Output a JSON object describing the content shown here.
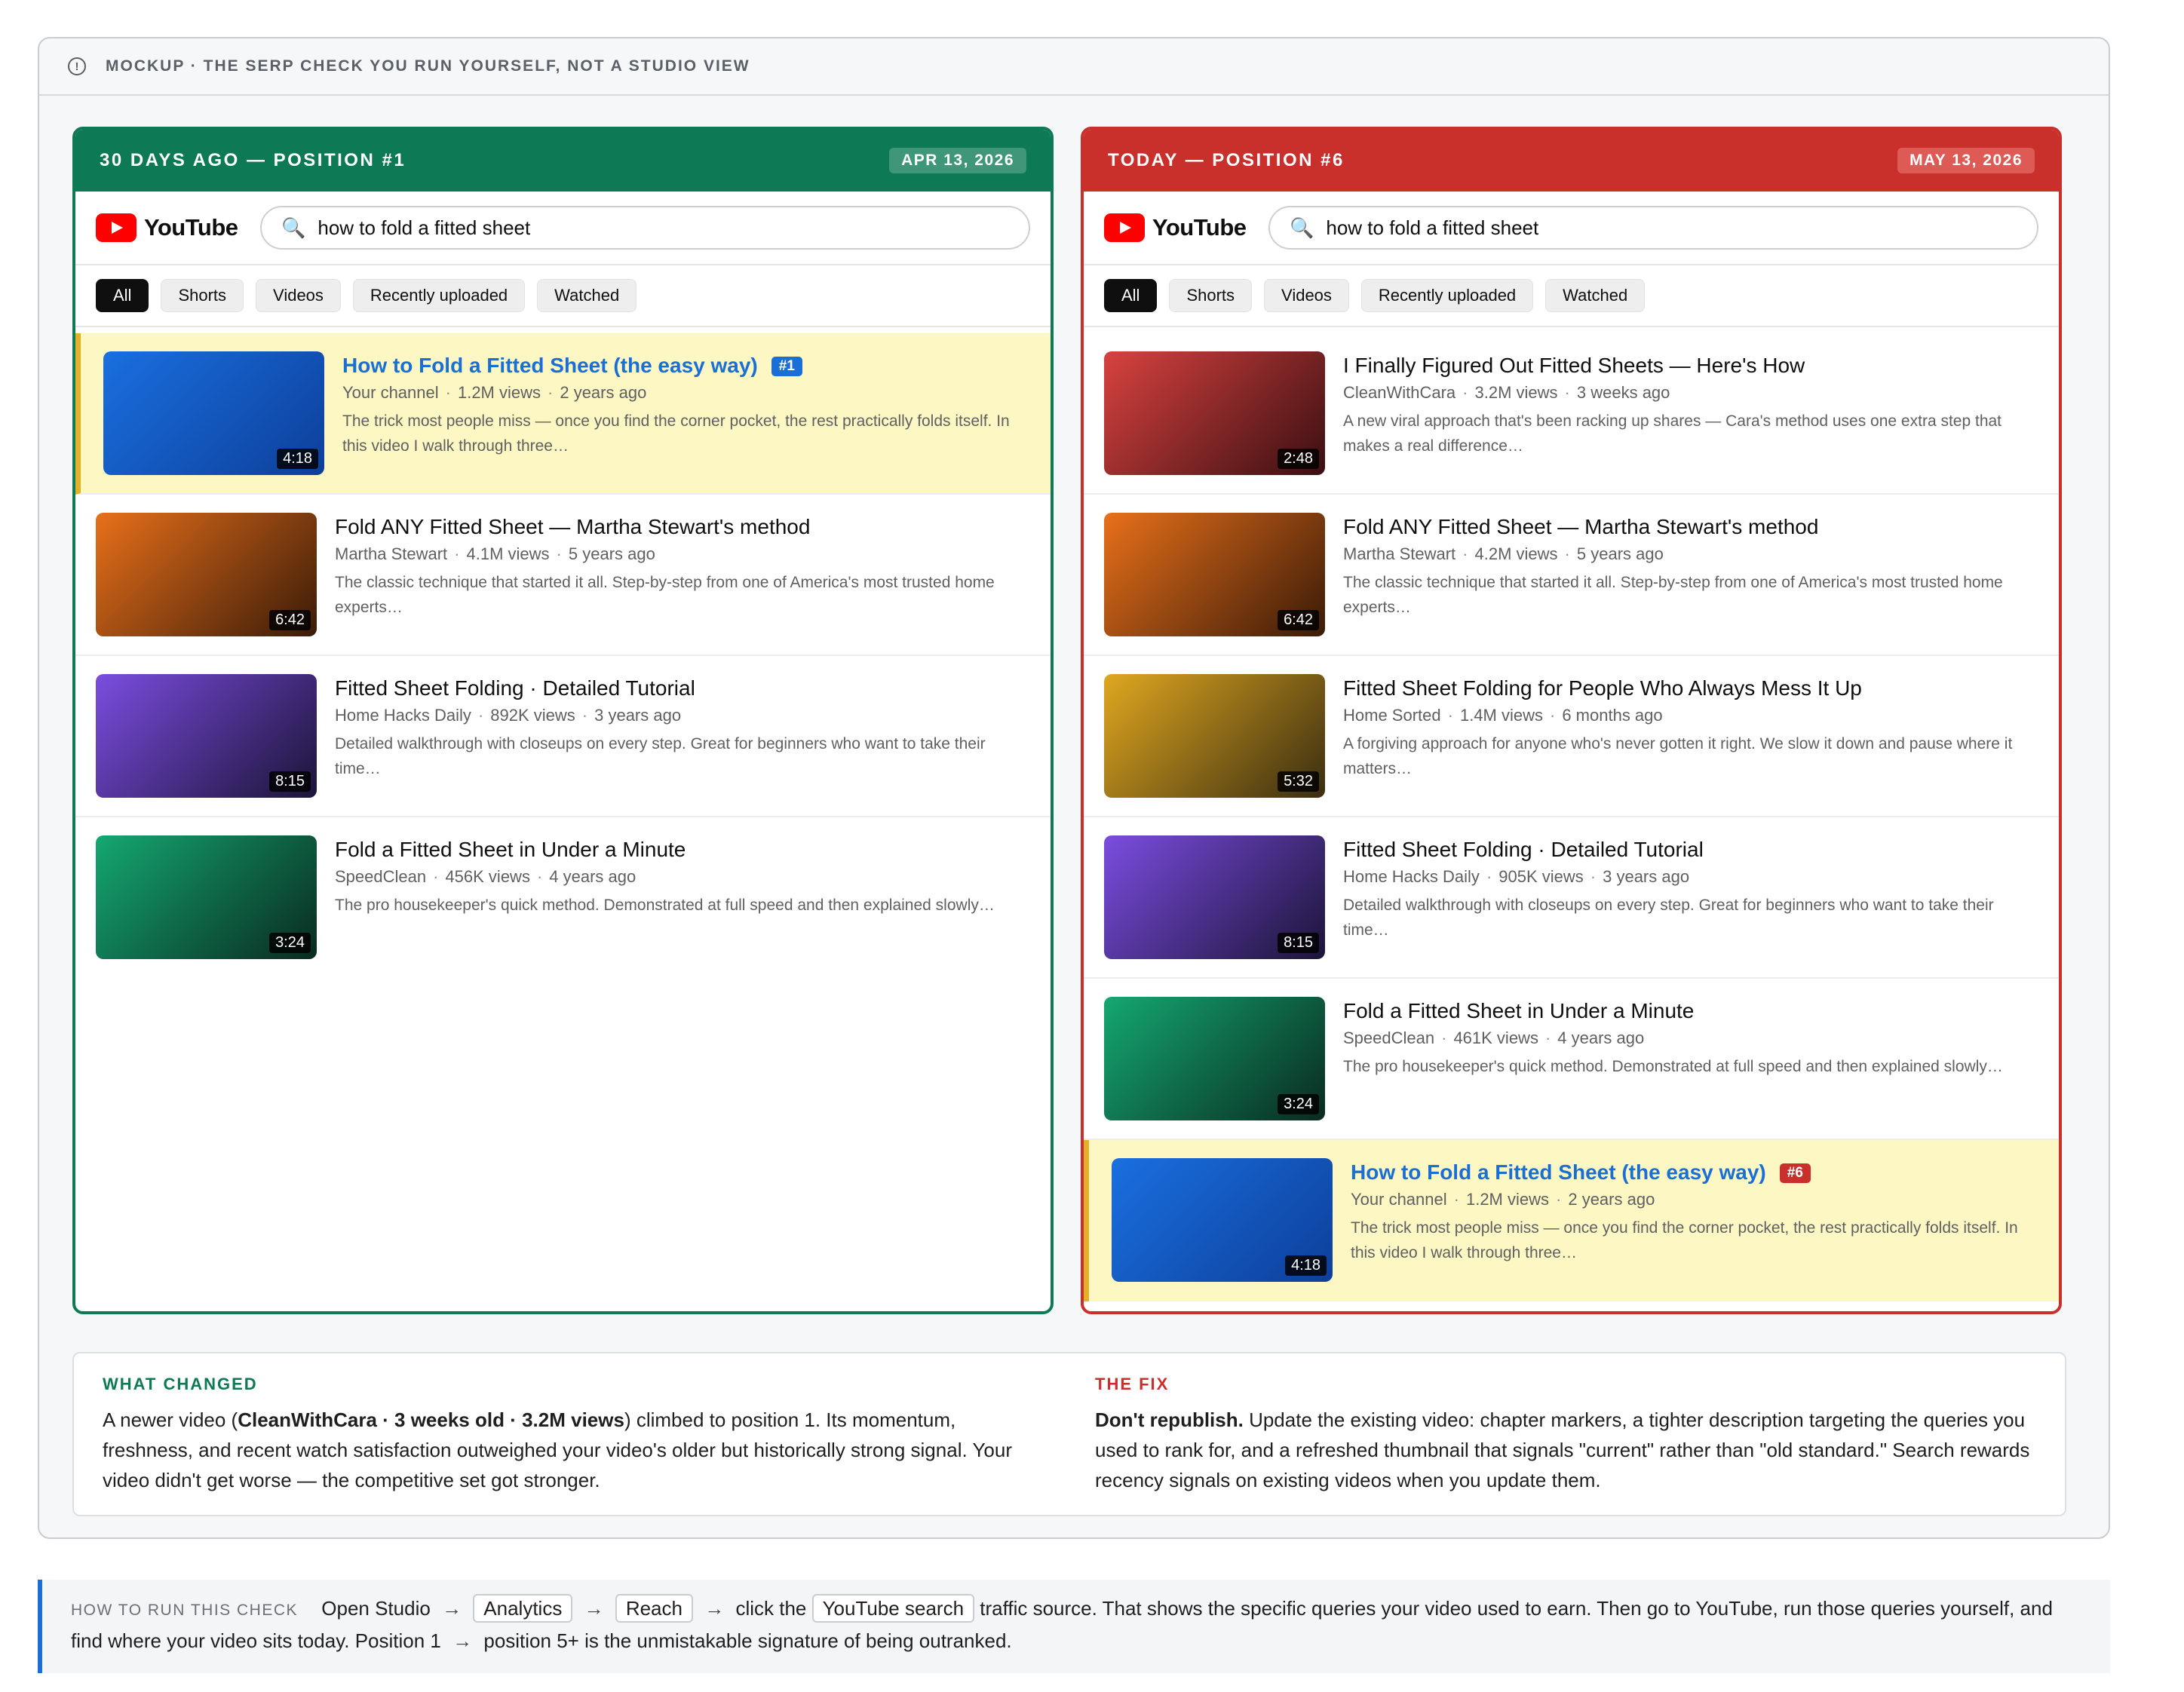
{
  "banner": {
    "icon": "info-icon",
    "text": "MOCKUP · THE SERP CHECK YOU RUN YOURSELF, NOT A STUDIO VIEW"
  },
  "search_query": "how to fold a fitted sheet",
  "youtube_wordmark": "YouTube",
  "filters": [
    "All",
    "Shorts",
    "Videos",
    "Recently uploaded",
    "Watched"
  ],
  "colors": {
    "before_accent": "#0e7a55",
    "after_accent": "#c9302c",
    "highlight_bg": "#fdf7c4",
    "link_blue": "#1a6fd6"
  },
  "left_panel": {
    "heading": "30 DAYS AGO — POSITION #1",
    "date": "APR 13, 2026",
    "results": [
      {
        "title": "How to Fold a Fitted Sheet (the easy way)",
        "badge": "#1",
        "channel": "Your channel",
        "views": "1.2M views",
        "age": "2 years ago",
        "description": "The trick most people miss — once you find the corner pocket, the rest practically folds itself. In this video I walk through three…",
        "duration": "4:18",
        "thumb_colors": [
          "#1a6fe0",
          "#0d3f9a"
        ]
      },
      {
        "title": "Fold ANY Fitted Sheet — Martha Stewart's method",
        "channel": "Martha Stewart",
        "views": "4.1M views",
        "age": "5 years ago",
        "description": "The classic technique that started it all. Step-by-step from one of America's most trusted home experts…",
        "duration": "6:42",
        "thumb_colors": [
          "#e8701a",
          "#3a1b08"
        ]
      },
      {
        "title": "Fitted Sheet Folding · Detailed Tutorial",
        "channel": "Home Hacks Daily",
        "views": "892K views",
        "age": "3 years ago",
        "description": "Detailed walkthrough with closeups on every step. Great for beginners who want to take their time…",
        "duration": "8:15",
        "thumb_colors": [
          "#7b4de0",
          "#1c1438"
        ]
      },
      {
        "title": "Fold a Fitted Sheet in Under a Minute",
        "channel": "SpeedClean",
        "views": "456K views",
        "age": "4 years ago",
        "description": "The pro housekeeper's quick method. Demonstrated at full speed and then explained slowly…",
        "duration": "3:24",
        "thumb_colors": [
          "#14a872",
          "#0a2a20"
        ]
      }
    ]
  },
  "right_panel": {
    "heading": "TODAY — POSITION #6",
    "date": "MAY 13, 2026",
    "results": [
      {
        "title": "I Finally Figured Out Fitted Sheets — Here's How",
        "channel": "CleanWithCara",
        "views": "3.2M views",
        "age": "3 weeks ago",
        "description": "A new viral approach that's been racking up shares — Cara's method uses one extra step that makes a real difference…",
        "duration": "2:48",
        "thumb_colors": [
          "#d8423f",
          "#3a0f12"
        ]
      },
      {
        "title": "Fold ANY Fitted Sheet — Martha Stewart's method",
        "channel": "Martha Stewart",
        "views": "4.2M views",
        "age": "5 years ago",
        "description": "The classic technique that started it all. Step-by-step from one of America's most trusted home experts…",
        "duration": "6:42",
        "thumb_colors": [
          "#e8701a",
          "#3a1b08"
        ]
      },
      {
        "title": "Fitted Sheet Folding for People Who Always Mess It Up",
        "channel": "Home Sorted",
        "views": "1.4M views",
        "age": "6 months ago",
        "description": "A forgiving approach for anyone who's never gotten it right. We slow it down and pause where it matters…",
        "duration": "5:32",
        "thumb_colors": [
          "#e0a820",
          "#3a2d10"
        ]
      },
      {
        "title": "Fitted Sheet Folding · Detailed Tutorial",
        "channel": "Home Hacks Daily",
        "views": "905K views",
        "age": "3 years ago",
        "description": "Detailed walkthrough with closeups on every step. Great for beginners who want to take their time…",
        "duration": "8:15",
        "thumb_colors": [
          "#7b4de0",
          "#1c1438"
        ]
      },
      {
        "title": "Fold a Fitted Sheet in Under a Minute",
        "channel": "SpeedClean",
        "views": "461K views",
        "age": "4 years ago",
        "description": "The pro housekeeper's quick method. Demonstrated at full speed and then explained slowly…",
        "duration": "3:24",
        "thumb_colors": [
          "#14a872",
          "#0a2a20"
        ]
      },
      {
        "title": "How to Fold a Fitted Sheet (the easy way)",
        "badge": "#6",
        "channel": "Your channel",
        "views": "1.2M views",
        "age": "2 years ago",
        "description": "The trick most people miss — once you find the corner pocket, the rest practically folds itself. In this video I walk through three…",
        "duration": "4:18",
        "thumb_colors": [
          "#1a6fe0",
          "#0d3f9a"
        ]
      }
    ]
  },
  "what_changed": {
    "heading": "WHAT CHANGED",
    "text_before": "A newer video (",
    "text_bold": "CleanWithCara · 3 weeks old · 3.2M views",
    "text_after": ") climbed to position 1. Its momentum, freshness, and recent watch satisfaction outweighed your video's older but historically strong signal. Your video didn't get worse — the competitive set got stronger."
  },
  "the_fix": {
    "heading": "THE FIX",
    "text_bold": "Don't republish.",
    "text_after": " Update the existing video: chapter markers, a tighter description targeting the queries you used to rank for, and a refreshed thumbnail that signals \"current\" rather than \"old standard.\" Search rewards recency signals on existing videos when you update them."
  },
  "how_to": {
    "label": "HOW TO RUN THIS CHECK",
    "step_open": "Open Studio",
    "arrow": "→",
    "step_analytics": "Analytics",
    "step_reach": "Reach",
    "click_text": "click the",
    "step_source": "YouTube search",
    "text_after": "traffic source. That shows the specific queries your video used to earn. Then go to YouTube, run those queries yourself, and find where your video sits today. Position 1",
    "text_end": "position 5+ is the unmistakable signature of being outranked."
  }
}
